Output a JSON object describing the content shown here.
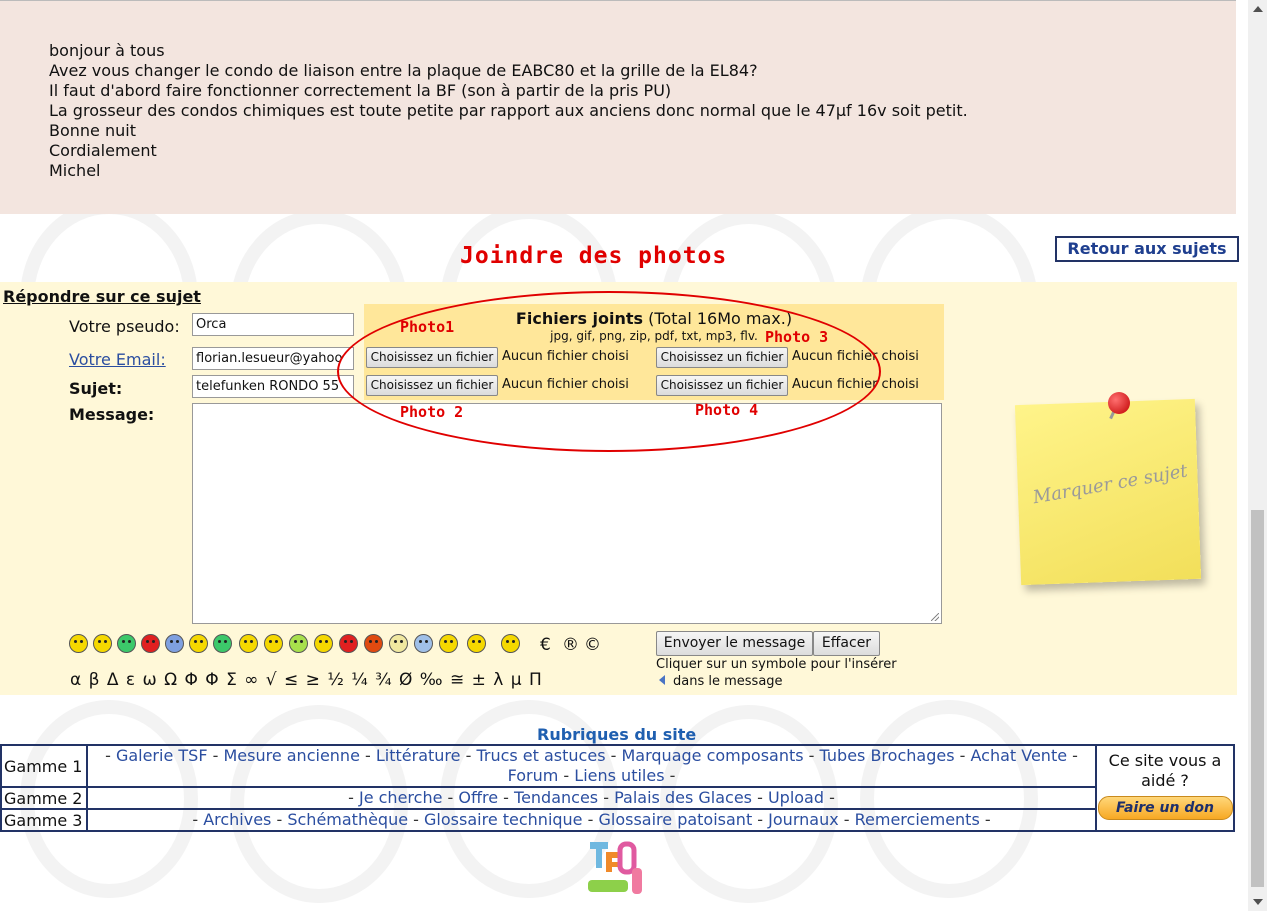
{
  "message": {
    "lines": [
      "bonjour à tous",
      "Avez vous changer le condo de liaison entre la plaque de EABC80 et la grille de la EL84?",
      "Il faut d'abord faire fonctionner correctement la BF (son à partir de la pris PU)",
      "La grosseur des condos chimiques est toute petite par rapport aux anciens donc normal que le 47µf 16v soit petit.",
      "Bonne nuit",
      "Cordialement",
      "Michel"
    ]
  },
  "annotation": {
    "heading": "Joindre des photos",
    "photo1": "Photo1",
    "photo2": "Photo 2",
    "photo3": "Photo 3",
    "photo4": "Photo 4"
  },
  "retour_label": "Retour aux sujets",
  "form": {
    "reply_title": "Répondre sur ce sujet",
    "pseudo_label": "Votre pseudo:",
    "pseudo_value": "Orca",
    "email_label": "Votre Email:",
    "email_value": "florian.lesueur@yahoo",
    "subject_label": "Sujet:",
    "subject_value": "telefunken RONDO 55",
    "message_label": "Message:",
    "files_title_bold": "Fichiers joints",
    "files_title_rest": " (Total 16Mo max.)",
    "files_types": "jpg, gif, png, zip, pdf, txt, mp3, flv.",
    "choose_file": "Choisissez un fichier",
    "no_file": "Aucun fichier choisi",
    "send_button": "Envoyer le message",
    "clear_button": "Effacer",
    "hint_line1": "Cliquer sur un symbole pour l'insérer",
    "hint_line2": "dans le message",
    "symbols": "α β Δ ε ω Ω Φ Φ Σ ∞ √ ≤ ≥ ½ ¼ ¾ Ø ‰ ≅ ± λ μ Π",
    "extra_symbols": [
      "€",
      "®",
      "©"
    ],
    "note_text": "Marquer ce sujet"
  },
  "rubriques": {
    "title": "Rubriques du site",
    "rows": [
      {
        "label": "Gamme 1",
        "links": [
          "Galerie TSF",
          "Mesure ancienne",
          "Littérature",
          "Trucs et astuces",
          "Marquage composants",
          "Tubes Brochages",
          "Achat Vente",
          "Forum",
          "Liens utiles"
        ]
      },
      {
        "label": "Gamme 2",
        "links": [
          "Je cherche",
          "Offre",
          "Tendances",
          "Palais des Glaces",
          "Upload"
        ]
      },
      {
        "label": "Gamme 3",
        "links": [
          "Archives",
          "Schémathèque",
          "Glossaire technique",
          "Glossaire patoisant",
          "Journaux",
          "Remerciements"
        ]
      }
    ],
    "side_question": "Ce site vous a aidé ?",
    "donate_label": "Faire un don"
  },
  "colors": {
    "annotation_red": "#e00000",
    "link_blue": "#2b4ea0",
    "message_bg": "#f3e5df",
    "form_bg": "#fff8d8",
    "files_bg": "#ffe79a"
  },
  "smiley_colors": [
    "#f5d800",
    "#f5d800",
    "#3cc86a",
    "#e02020",
    "#7fa0e0",
    "#f5d800",
    "#3cc86a",
    "#f5d800",
    "#f5d800",
    "#a8e04c",
    "#f5d800",
    "#e02020",
    "#e04a10",
    "#f0e8a0",
    "#a0c0e8",
    "#f5d800",
    "#f5d800",
    "#f5d800"
  ]
}
